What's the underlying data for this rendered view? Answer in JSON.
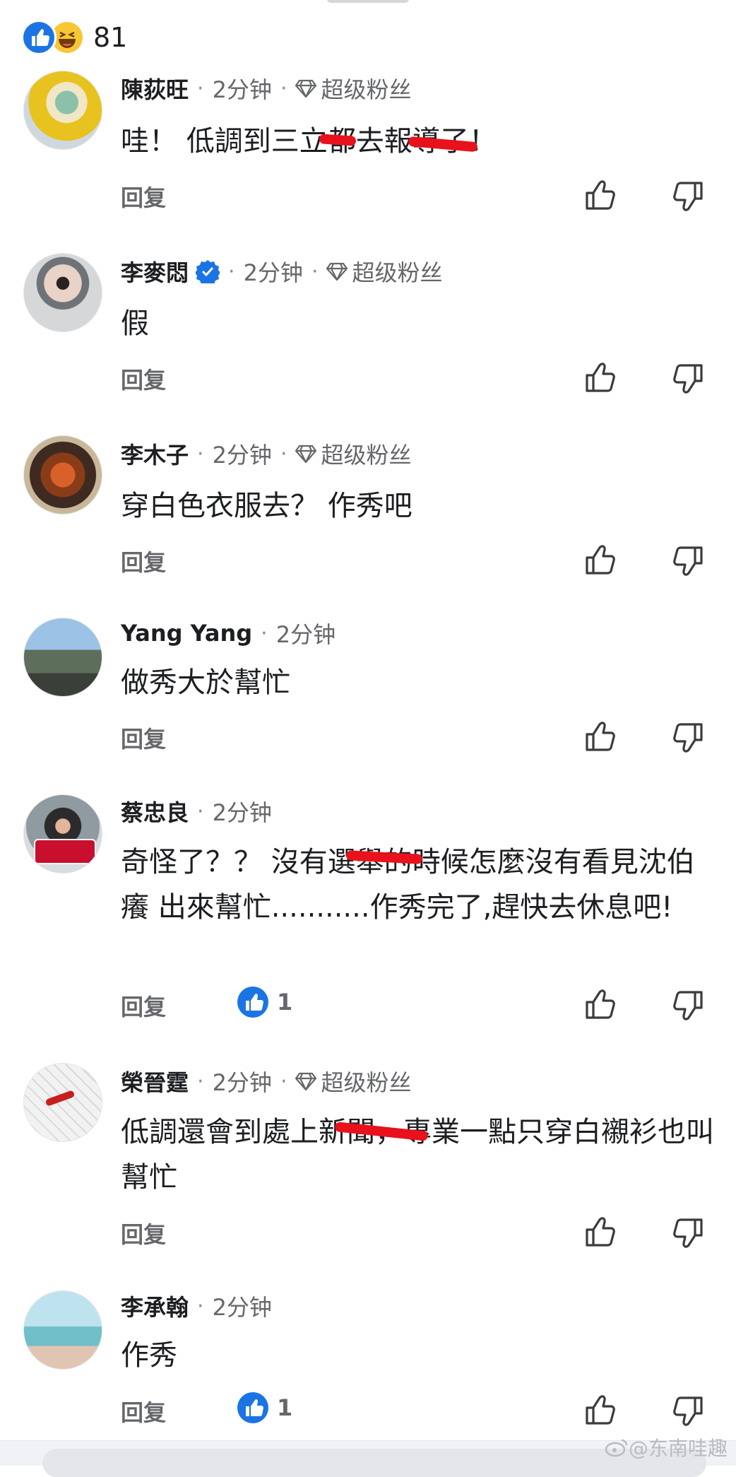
{
  "reactions": {
    "count": "81",
    "icons": [
      "like-icon",
      "haha-icon"
    ]
  },
  "labels": {
    "reply": "回复",
    "fan": "超级粉丝"
  },
  "comments": [
    {
      "name": "陳荻旺",
      "time": "2分钟",
      "fan": true,
      "verified": false,
      "text": "哇！ 低調到三立都去報導了！",
      "likes": null
    },
    {
      "name": "李麥悶",
      "time": "2分钟",
      "fan": true,
      "verified": true,
      "text": "假",
      "likes": null
    },
    {
      "name": "李木子",
      "time": "2分钟",
      "fan": true,
      "verified": false,
      "text": "穿白色衣服去？ 作秀吧",
      "likes": null
    },
    {
      "name": "Yang Yang",
      "time": "2分钟",
      "fan": false,
      "verified": false,
      "text": "做秀大於幫忙",
      "likes": null
    },
    {
      "name": "蔡忠良",
      "time": "2分钟",
      "fan": false,
      "verified": false,
      "text": "奇怪了？？ 沒有選舉的時候怎麼沒有看見沈伯癢 出來幫忙...........作秀完了,趕快去休息吧!",
      "likes": "1"
    },
    {
      "name": "榮晉霆",
      "time": "2分钟",
      "fan": true,
      "verified": false,
      "text": "低調還會到處上新聞，專業一點只穿白襯衫也叫幫忙",
      "likes": null
    },
    {
      "name": "李承翰",
      "time": "2分钟",
      "fan": false,
      "verified": false,
      "text": "作秀",
      "likes": "1"
    }
  ],
  "watermark": "@东南哇趣",
  "colors": {
    "accent": "#1b74e4",
    "secondary_text": "#65676b",
    "redaction": "#e8111c"
  }
}
